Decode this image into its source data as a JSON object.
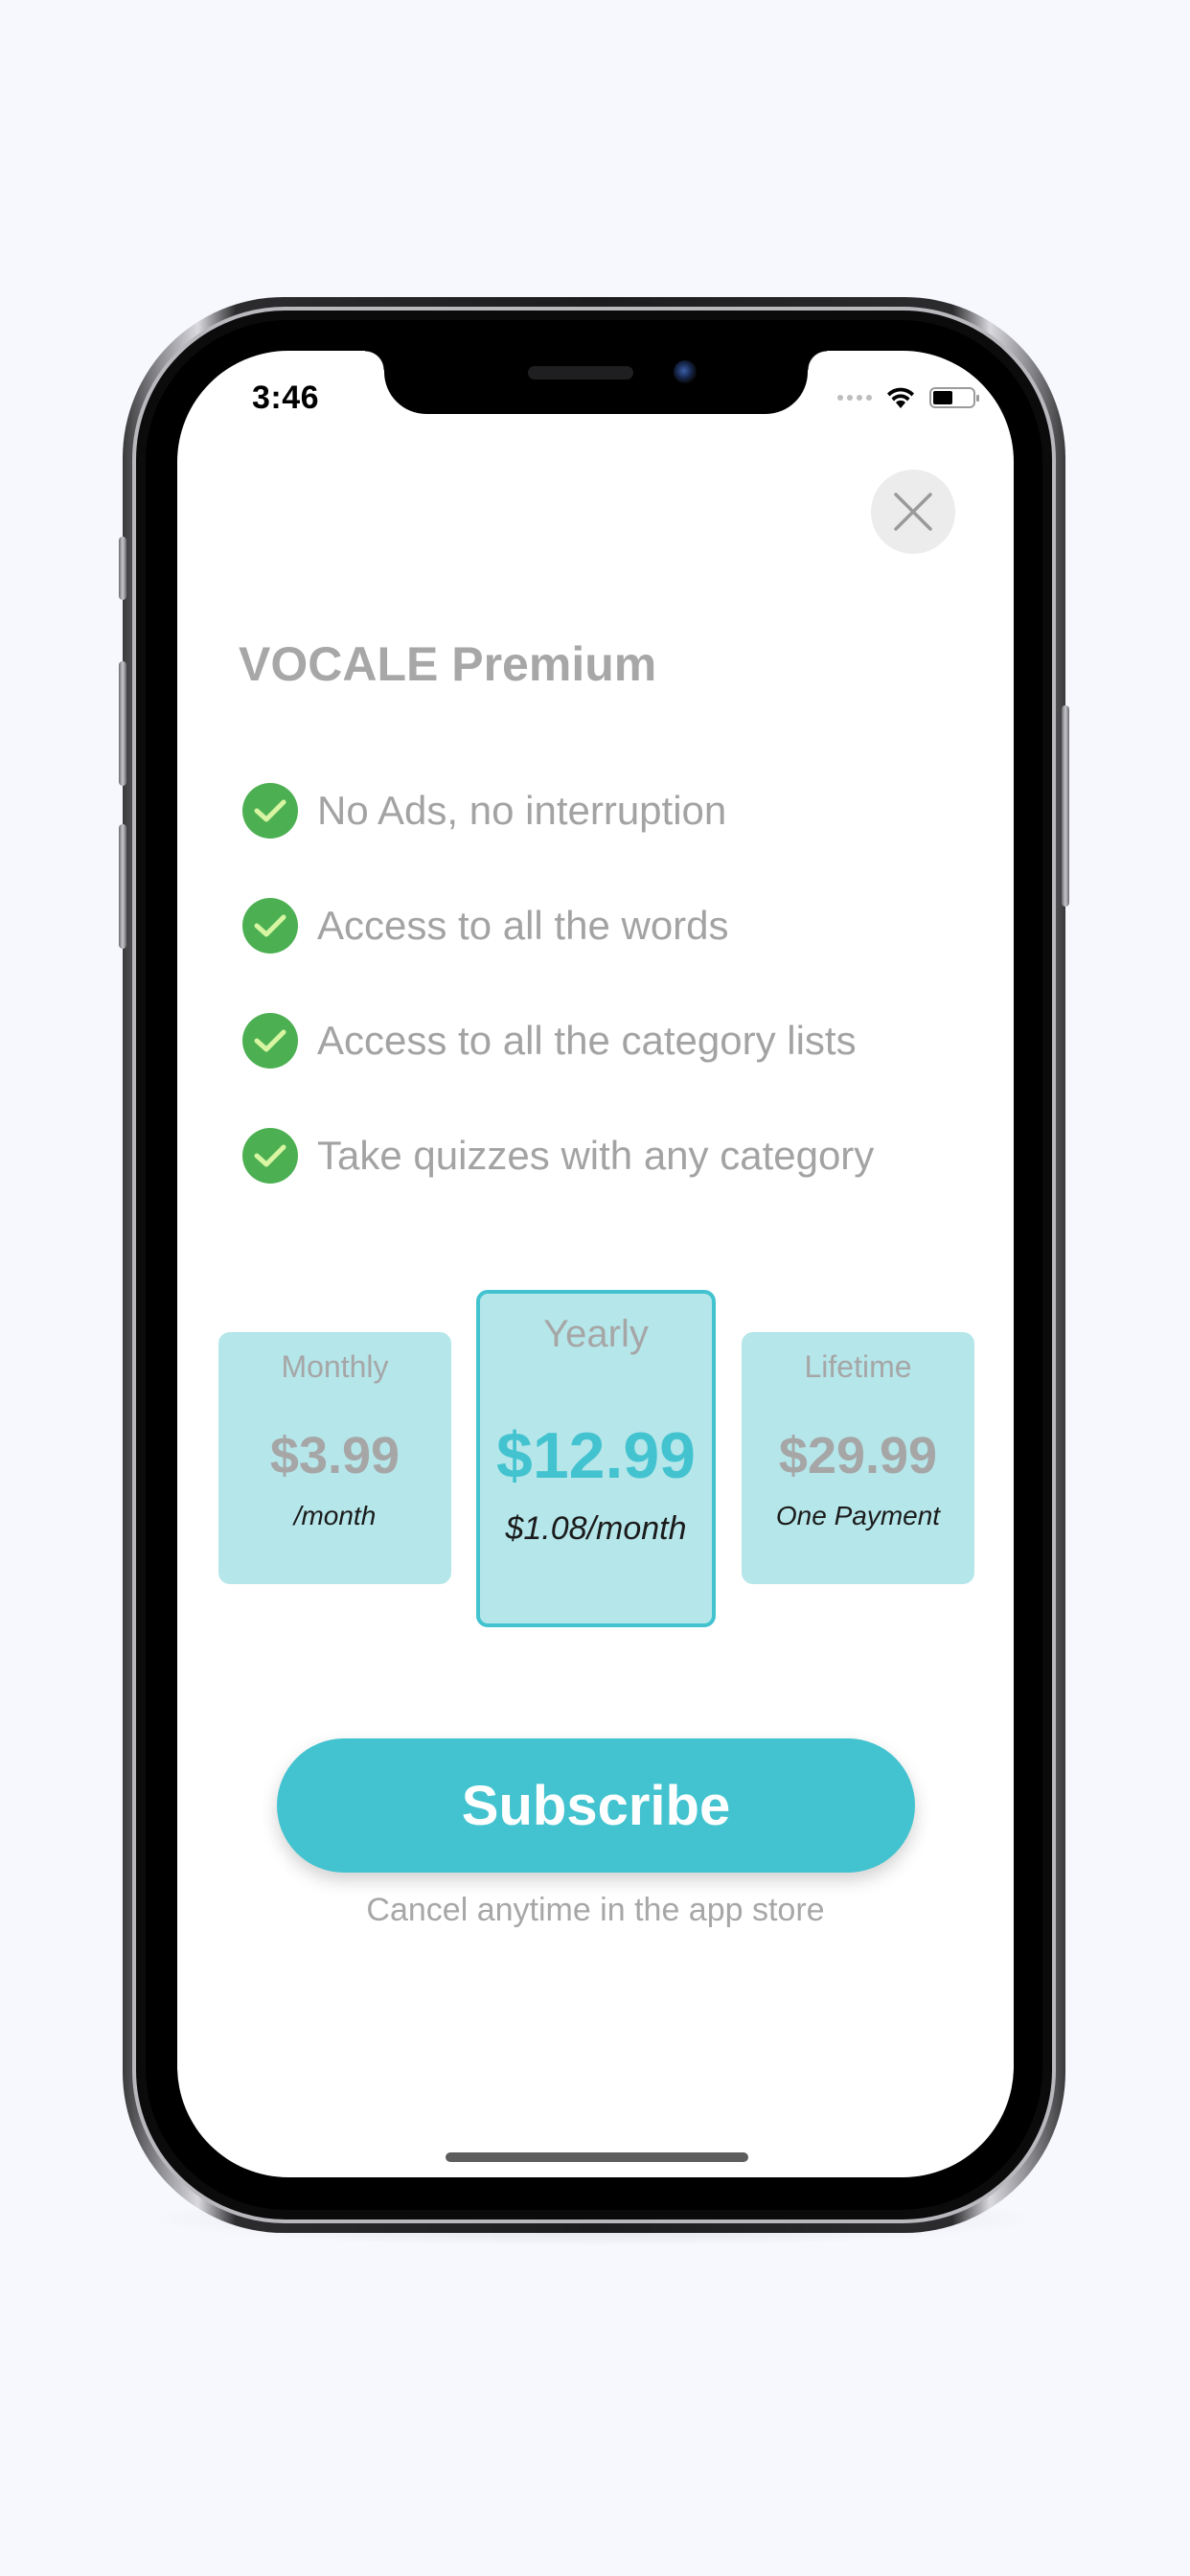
{
  "status_bar": {
    "time": "3:46"
  },
  "paywall": {
    "title": "VOCALE Premium",
    "features": [
      {
        "text": "No Ads, no interruption"
      },
      {
        "text": "Access to all the words"
      },
      {
        "text": "Access to all the category lists"
      },
      {
        "text": "Take quizzes with any category"
      }
    ],
    "plans": {
      "monthly": {
        "name": "Monthly",
        "price": "$3.99",
        "sub": "/month"
      },
      "yearly": {
        "name": "Yearly",
        "price": "$12.99",
        "sub": "$1.08/month",
        "selected": true
      },
      "lifetime": {
        "name": "Lifetime",
        "price": "$29.99",
        "sub": "One Payment"
      }
    },
    "subscribe_label": "Subscribe",
    "cancel_note": "Cancel anytime in the app store"
  },
  "colors": {
    "accent": "#43c3cf",
    "plan_bg": "#b5e6ea",
    "check_green": "#4cb052",
    "muted_text": "#a7a7a7",
    "page_bg": "#f6f8fe"
  },
  "icons": [
    "close-icon",
    "checkmark-icon",
    "wifi-icon",
    "battery-icon",
    "signal-icon"
  ]
}
